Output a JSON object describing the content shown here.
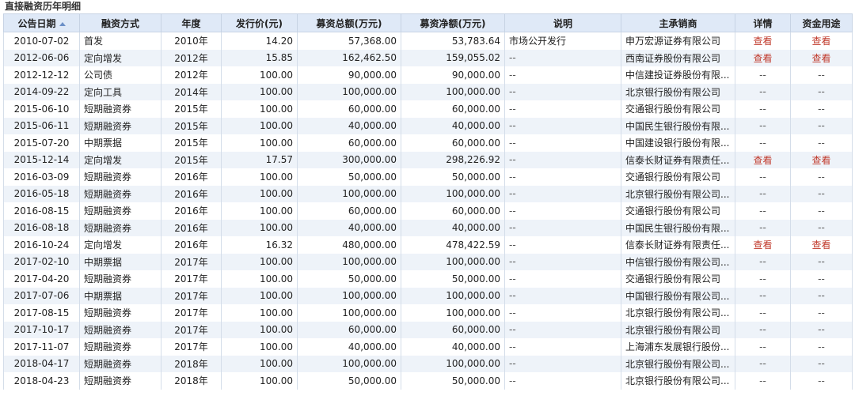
{
  "section_title": "直接融资历年明细",
  "columns": [
    "公告日期",
    "融资方式",
    "年度",
    "发行价(元)",
    "募资总额(万元)",
    "募资净额(万元)",
    "说明",
    "主承销商",
    "详情",
    "资金用途"
  ],
  "sorted_column": "公告日期",
  "link_color": "#c0392b",
  "rows": [
    {
      "date": "2010-07-02",
      "method": "首发",
      "year": "2010年",
      "price": "14.20",
      "total": "57,368.00",
      "net": "53,783.64",
      "note": "市场公开发行",
      "underwriter": "申万宏源证券有限公司",
      "detail": "查看",
      "usage": "查看"
    },
    {
      "date": "2012-06-06",
      "method": "定向增发",
      "year": "2012年",
      "price": "15.85",
      "total": "162,462.50",
      "net": "159,055.02",
      "note": "--",
      "underwriter": "西南证券股份有限公司",
      "detail": "查看",
      "usage": "查看"
    },
    {
      "date": "2012-12-12",
      "method": "公司债",
      "year": "2012年",
      "price": "100.00",
      "total": "90,000.00",
      "net": "90,000.00",
      "note": "--",
      "underwriter": "中信建投证券股份有限...",
      "detail": "--",
      "usage": "--"
    },
    {
      "date": "2014-09-22",
      "method": "定向工具",
      "year": "2014年",
      "price": "100.00",
      "total": "100,000.00",
      "net": "100,000.00",
      "note": "--",
      "underwriter": "北京银行股份有限公司",
      "detail": "--",
      "usage": "--"
    },
    {
      "date": "2015-06-10",
      "method": "短期融资券",
      "year": "2015年",
      "price": "100.00",
      "total": "60,000.00",
      "net": "60,000.00",
      "note": "--",
      "underwriter": "交通银行股份有限公司",
      "detail": "--",
      "usage": "--"
    },
    {
      "date": "2015-06-11",
      "method": "短期融资券",
      "year": "2015年",
      "price": "100.00",
      "total": "40,000.00",
      "net": "40,000.00",
      "note": "--",
      "underwriter": "中国民生银行股份有限...",
      "detail": "--",
      "usage": "--"
    },
    {
      "date": "2015-07-20",
      "method": "中期票据",
      "year": "2015年",
      "price": "100.00",
      "total": "60,000.00",
      "net": "60,000.00",
      "note": "--",
      "underwriter": "中国建设银行股份有限...",
      "detail": "--",
      "usage": "--"
    },
    {
      "date": "2015-12-14",
      "method": "定向增发",
      "year": "2015年",
      "price": "17.57",
      "total": "300,000.00",
      "net": "298,226.92",
      "note": "--",
      "underwriter": "信泰长财证券有限责任...",
      "detail": "查看",
      "usage": "查看"
    },
    {
      "date": "2016-03-09",
      "method": "短期融资券",
      "year": "2016年",
      "price": "100.00",
      "total": "50,000.00",
      "net": "50,000.00",
      "note": "--",
      "underwriter": "交通银行股份有限公司",
      "detail": "--",
      "usage": "--"
    },
    {
      "date": "2016-05-18",
      "method": "短期融资券",
      "year": "2016年",
      "price": "100.00",
      "total": "100,000.00",
      "net": "100,000.00",
      "note": "--",
      "underwriter": "北京银行股份有限公司...",
      "detail": "--",
      "usage": "--"
    },
    {
      "date": "2016-08-15",
      "method": "短期融资券",
      "year": "2016年",
      "price": "100.00",
      "total": "60,000.00",
      "net": "60,000.00",
      "note": "--",
      "underwriter": "交通银行股份有限公司",
      "detail": "--",
      "usage": "--"
    },
    {
      "date": "2016-08-18",
      "method": "短期融资券",
      "year": "2016年",
      "price": "100.00",
      "total": "40,000.00",
      "net": "40,000.00",
      "note": "--",
      "underwriter": "中国民生银行股份有限...",
      "detail": "--",
      "usage": "--"
    },
    {
      "date": "2016-10-24",
      "method": "定向增发",
      "year": "2016年",
      "price": "16.32",
      "total": "480,000.00",
      "net": "478,422.59",
      "note": "--",
      "underwriter": "信泰长财证券有限责任...",
      "detail": "查看",
      "usage": "查看"
    },
    {
      "date": "2017-02-10",
      "method": "中期票据",
      "year": "2017年",
      "price": "100.00",
      "total": "100,000.00",
      "net": "100,000.00",
      "note": "--",
      "underwriter": "中信银行股份有限公司...",
      "detail": "--",
      "usage": "--"
    },
    {
      "date": "2017-04-20",
      "method": "短期融资券",
      "year": "2017年",
      "price": "100.00",
      "total": "50,000.00",
      "net": "50,000.00",
      "note": "--",
      "underwriter": "交通银行股份有限公司",
      "detail": "--",
      "usage": "--"
    },
    {
      "date": "2017-07-06",
      "method": "中期票据",
      "year": "2017年",
      "price": "100.00",
      "total": "100,000.00",
      "net": "100,000.00",
      "note": "--",
      "underwriter": "中国银行股份有限公司...",
      "detail": "--",
      "usage": "--"
    },
    {
      "date": "2017-08-15",
      "method": "短期融资券",
      "year": "2017年",
      "price": "100.00",
      "total": "100,000.00",
      "net": "100,000.00",
      "note": "--",
      "underwriter": "北京银行股份有限公司...",
      "detail": "--",
      "usage": "--"
    },
    {
      "date": "2017-10-17",
      "method": "短期融资券",
      "year": "2017年",
      "price": "100.00",
      "total": "60,000.00",
      "net": "60,000.00",
      "note": "--",
      "underwriter": "北京银行股份有限公司",
      "detail": "--",
      "usage": "--"
    },
    {
      "date": "2017-11-07",
      "method": "短期融资券",
      "year": "2017年",
      "price": "100.00",
      "total": "40,000.00",
      "net": "40,000.00",
      "note": "--",
      "underwriter": "上海浦东发展银行股份...",
      "detail": "--",
      "usage": "--"
    },
    {
      "date": "2018-04-17",
      "method": "短期融资券",
      "year": "2018年",
      "price": "100.00",
      "total": "100,000.00",
      "net": "100,000.00",
      "note": "--",
      "underwriter": "北京银行股份有限公司...",
      "detail": "--",
      "usage": "--"
    },
    {
      "date": "2018-04-23",
      "method": "短期融资券",
      "year": "2018年",
      "price": "100.00",
      "total": "50,000.00",
      "net": "50,000.00",
      "note": "--",
      "underwriter": "北京银行股份有限公司...",
      "detail": "--",
      "usage": "--"
    }
  ]
}
